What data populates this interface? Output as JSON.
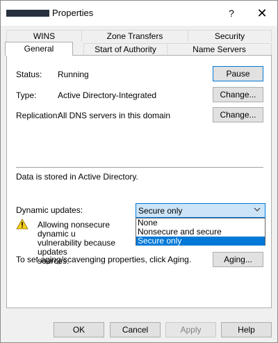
{
  "window": {
    "title": "Properties",
    "help_glyph": "?",
    "close_glyph": "✕"
  },
  "tabs": {
    "row1": [
      "WINS",
      "Zone Transfers",
      "Security"
    ],
    "row2": [
      "General",
      "Start of Authority (SOA)",
      "Name Servers"
    ],
    "active": "General"
  },
  "general": {
    "status_label": "Status:",
    "status_value": "Running",
    "pause_button": "Pause",
    "type_label": "Type:",
    "type_value": "Active Directory-Integrated",
    "type_change_button": "Change...",
    "replication_label": "Replication:",
    "replication_value": "All DNS servers in this domain",
    "replication_change_button": "Change...",
    "storage_text": "Data is stored in Active Directory.",
    "dynamic_updates_label": "Dynamic updates:",
    "dynamic_updates_selected": "Secure only",
    "dynamic_updates_options": [
      "None",
      "Nonsecure and secure",
      "Secure only"
    ],
    "warning_lines": [
      "Allowing nonsecure dynamic u",
      "vulnerability because updates",
      "sources."
    ],
    "aging_text": "To set aging/scavenging properties, click Aging.",
    "aging_button": "Aging..."
  },
  "footer": {
    "ok": "OK",
    "cancel": "Cancel",
    "apply": "Apply",
    "help": "Help"
  },
  "colors": {
    "accent": "#0078d7",
    "selection_bg": "#cce4f7",
    "warning_yellow": "#f7d21c"
  }
}
